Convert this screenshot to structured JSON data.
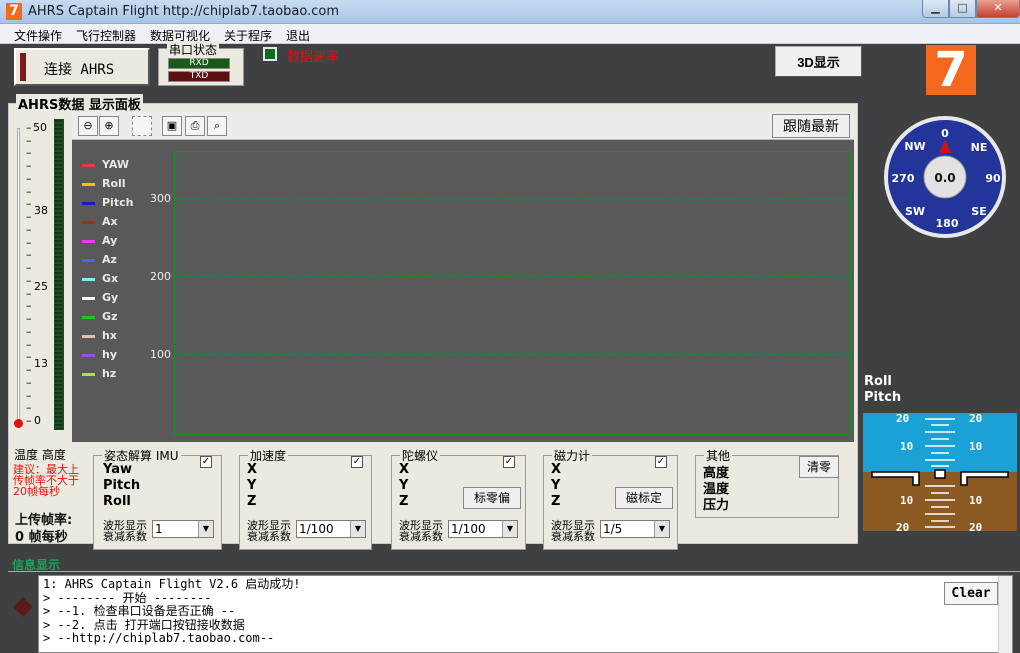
{
  "window": {
    "title": "AHRS Captain Flight http://chiplab7.taobao.com",
    "icon_text": "7"
  },
  "menu": [
    "文件操作",
    "飞行控制器",
    "数据可视化",
    "关于程序",
    "退出"
  ],
  "toolbar": {
    "connect_label": "连接 AHRS",
    "serial_title": "串口状态",
    "rxd": "RXD",
    "txd": "TXD",
    "rate_label": "数据速率",
    "btn_3d": "3D显示",
    "logo": "7"
  },
  "panel": {
    "title": "AHRS数据 显示面板",
    "thermo_ticks": [
      "50",
      "38",
      "25",
      "13",
      "0"
    ],
    "follow_btn": "跟随最新"
  },
  "chart_data": {
    "type": "line",
    "series": [
      {
        "name": "YAW",
        "color": "#e83c3c",
        "values": []
      },
      {
        "name": "Roll",
        "color": "#f5c400",
        "values": []
      },
      {
        "name": "Pitch",
        "color": "#1a1ad9",
        "values": []
      },
      {
        "name": "Ax",
        "color": "#8b3a1a",
        "values": []
      },
      {
        "name": "Ay",
        "color": "#e83ce8",
        "values": []
      },
      {
        "name": "Az",
        "color": "#3c6ee8",
        "values": []
      },
      {
        "name": "Gx",
        "color": "#8ce8f0",
        "values": []
      },
      {
        "name": "Gy",
        "color": "#ffffff",
        "values": []
      },
      {
        "name": "Gz",
        "color": "#22c222",
        "values": []
      },
      {
        "name": "hx",
        "color": "#e8c0a8",
        "values": []
      },
      {
        "name": "hy",
        "color": "#9a4ee8",
        "values": []
      },
      {
        "name": "hz",
        "color": "#a8e83c",
        "values": []
      }
    ],
    "y_ticks": [
      "300",
      "200",
      "100"
    ],
    "grid": true,
    "legend_position": "left"
  },
  "groups": {
    "imu": {
      "title": "姿态解算 IMU",
      "items": [
        "Yaw",
        "Pitch",
        "Roll"
      ],
      "wave_label": [
        "波形显示",
        "衰减系数"
      ],
      "combo": "1"
    },
    "accel": {
      "title": "加速度",
      "items": [
        "X",
        "Y",
        "Z"
      ],
      "wave_label": [
        "波形显示",
        "衰减系数"
      ],
      "combo": "1/100"
    },
    "gyro": {
      "title": "陀螺仪",
      "items": [
        "X",
        "Y",
        "Z"
      ],
      "wave_label": [
        "波形显示",
        "衰减系数"
      ],
      "combo": "1/100",
      "button": "标零偏"
    },
    "mag": {
      "title": "磁力计",
      "items": [
        "X",
        "Y",
        "Z"
      ],
      "wave_label": [
        "波形显示",
        "衰减系数"
      ],
      "combo": "1/5",
      "button": "磁标定"
    },
    "other": {
      "title": "其他",
      "items": [
        "高度",
        "温度",
        "压力"
      ],
      "button": "清零"
    }
  },
  "status": {
    "temp_alt": "温度  高度",
    "suggest": [
      "建议：最大上",
      "传帧率不大于",
      "20帧每秒"
    ],
    "upload_label": "上传帧率:",
    "fps": "0 帧每秒"
  },
  "compass": {
    "value": "0.0",
    "labels": [
      "0",
      "NE",
      "90",
      "SE",
      "180",
      "SW",
      "270",
      "NW"
    ]
  },
  "attitude": {
    "labels": [
      "Roll",
      "Pitch"
    ],
    "ticks": [
      "20",
      "10",
      "10",
      "20"
    ]
  },
  "info": {
    "title": "信息显示",
    "lines": [
      "1:  AHRS Captain Flight V2.6 启动成功!",
      ">  --------     开始     --------",
      ">  --1. 检查串口设备是否正确 --",
      ">  --2. 点击 打开端口按钮接收数据",
      ">  --http://chiplab7.taobao.com--"
    ],
    "clear_btn": "Clear"
  }
}
